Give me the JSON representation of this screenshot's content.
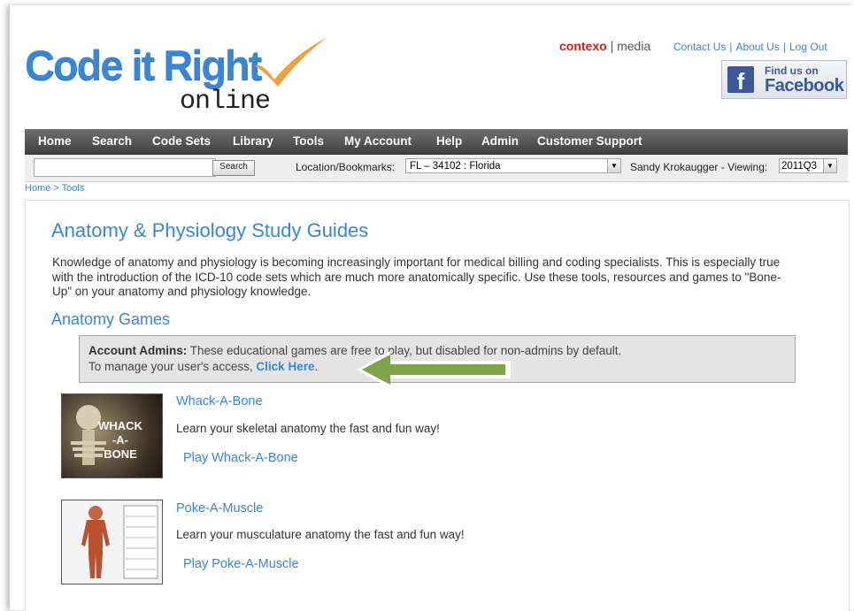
{
  "header": {
    "logo_main": "Code it Right",
    "logo_sub": "online",
    "vendor_brand": "contexo",
    "vendor_suffix": "media",
    "links": [
      "Contact Us",
      "About Us",
      "Log Out"
    ],
    "facebook_line1": "Find us on",
    "facebook_line2": "Facebook"
  },
  "nav": {
    "items": [
      "Home",
      "Search",
      "Code Sets",
      "Library",
      "Tools",
      "My Account",
      "Help",
      "Admin",
      "Customer Support"
    ]
  },
  "search": {
    "query": "",
    "button_label": "Search",
    "location_label": "Location/Bookmarks:",
    "location_value": "FL – 34102 : Florida",
    "user_label": "Sandy Krokaugger - Viewing:",
    "version_value": "2011Q3"
  },
  "breadcrumb": "Home > Tools",
  "main": {
    "title": "Anatomy & Physiology Study Guides",
    "intro": "Knowledge of anatomy and physiology is becoming increasingly important for medical billing and coding specialists.  This is especially true with the introduction of the ICD-10 code sets which are much more anatomically specific.  Use these tools, resources and games to \"Bone-Up\" on your anatomy and physiology knowledge.",
    "games_heading": "Anatomy Games",
    "notice": {
      "bold": "Account Admins:",
      "text1": " These educational games are free to play, but disabled for non-admins by default.",
      "text2": "To manage your user's access, ",
      "cta": "Click Here",
      "end": "."
    },
    "games": [
      {
        "title": "Whack-A-Bone",
        "desc": "Learn your skeletal anatomy the fast and fun way!",
        "play": "Play Whack-A-Bone",
        "thumb_text": [
          "WHACK",
          "-A-",
          "BONE"
        ]
      },
      {
        "title": "Poke-A-Muscle",
        "desc": "Learn your musculature anatomy the fast and fun way!",
        "play": "Play Poke-A-Muscle"
      }
    ]
  },
  "colors": {
    "accent": "#3a86d6",
    "nav_bg": "#4a4a4a",
    "arrow": "#7ea34a",
    "check": "#f0a03c",
    "brand_red": "#d32020"
  }
}
